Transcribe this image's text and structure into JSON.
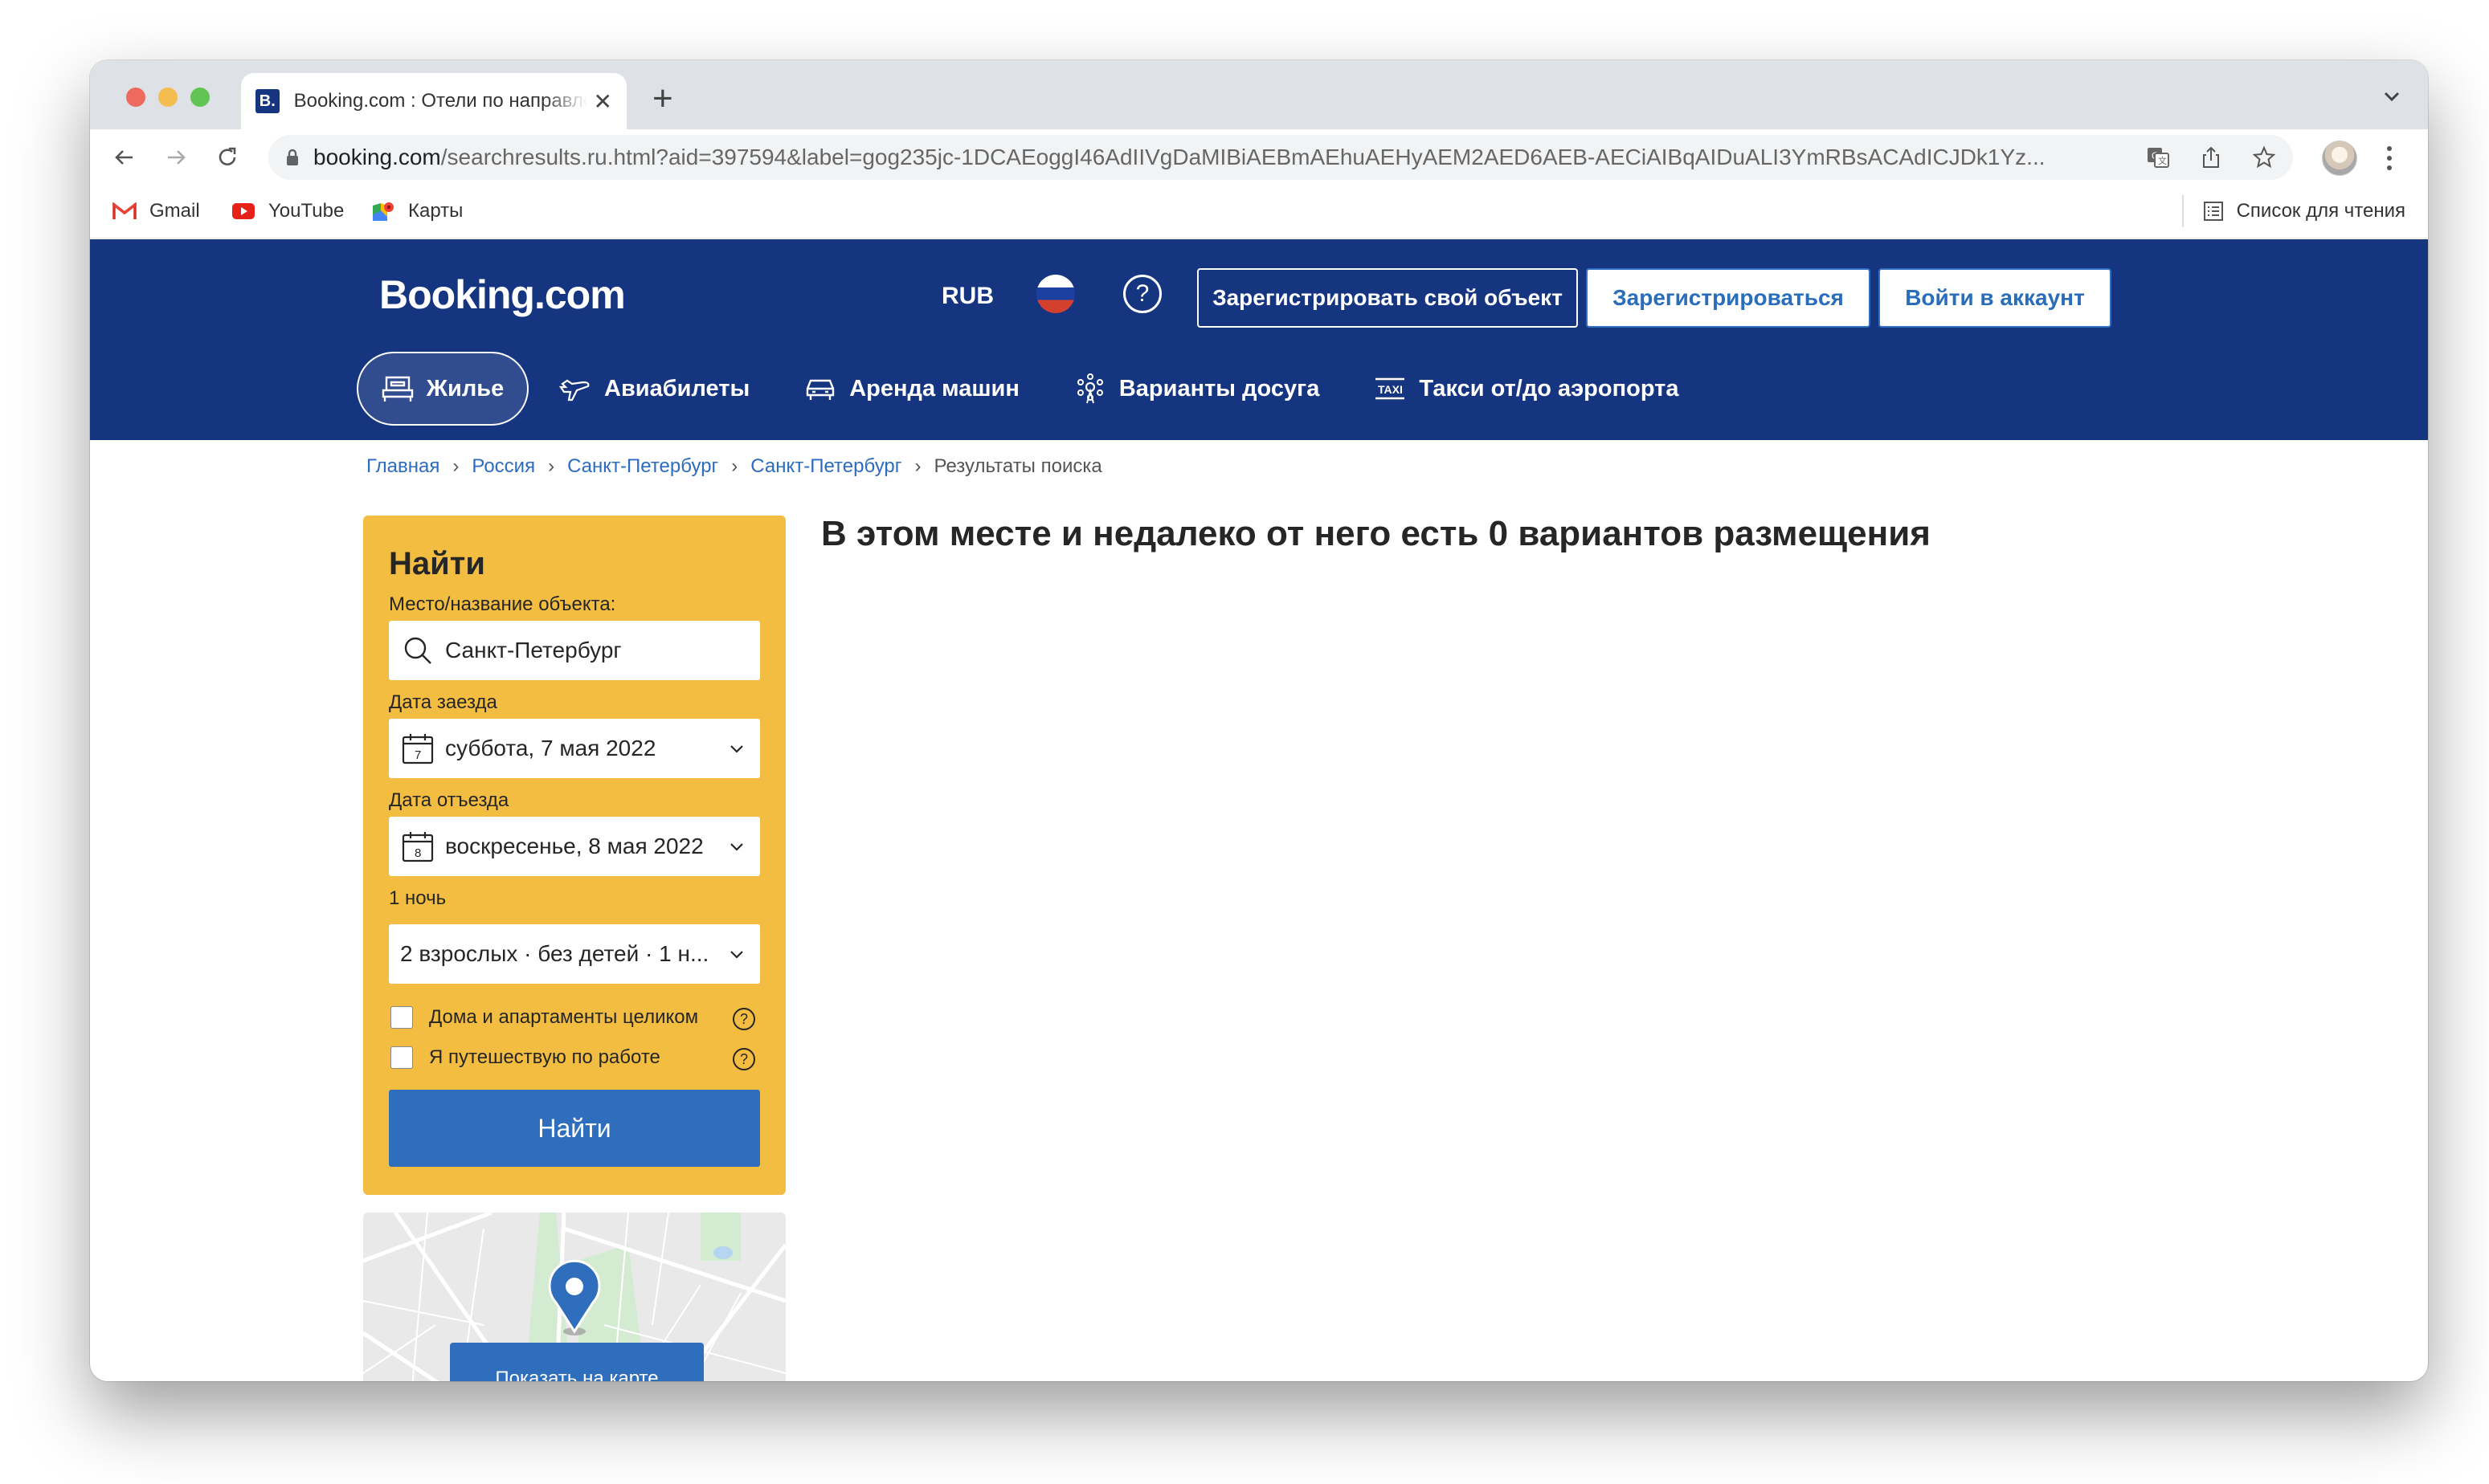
{
  "browser": {
    "tab": {
      "favicon": "B.",
      "title": "Booking.com : Отели по направлению Санкт-Петербург"
    },
    "url": {
      "host": "booking.com",
      "path": "/searchresults.ru.html?aid=397594&label=gog235jc-1DCAEoggI46AdIIVgDaMIBiAEBmAEhuAEHyAEM2AED6AEB-AECiAIBqAIDuALI3YmRBsACAdICJDk1Yz..."
    },
    "bookmarks": [
      {
        "label": "Gmail",
        "icon": "gmail-icon"
      },
      {
        "label": "YouTube",
        "icon": "youtube-icon"
      },
      {
        "label": "Карты",
        "icon": "maps-icon"
      }
    ],
    "reading_list": "Список для чтения"
  },
  "header": {
    "logo": "Booking.com",
    "currency": "RUB",
    "help": "?",
    "list_property": "Зарегистрировать свой объект",
    "register": "Зарегистрироваться",
    "sign_in": "Войти в аккаунт",
    "colors": {
      "brand_blue": "#163580",
      "action_blue": "#2f6ebd",
      "search_yellow": "#f3bd41"
    }
  },
  "nav": [
    {
      "label": "Жилье",
      "icon": "bed-icon",
      "active": true
    },
    {
      "label": "Авиабилеты",
      "icon": "plane-icon",
      "active": false
    },
    {
      "label": "Аренда машин",
      "icon": "car-icon",
      "active": false
    },
    {
      "label": "Варианты досуга",
      "icon": "attractions-icon",
      "active": false
    },
    {
      "label": "Такси от/до аэропорта",
      "icon": "taxi-icon",
      "active": false
    }
  ],
  "breadcrumb": [
    {
      "label": "Главная"
    },
    {
      "label": "Россия"
    },
    {
      "label": "Санкт-Петербург"
    },
    {
      "label": "Санкт-Петербург"
    },
    {
      "label": "Результаты поиска"
    }
  ],
  "search": {
    "title": "Найти",
    "destination_label": "Место/название объекта:",
    "destination_value": "Санкт-Петербург",
    "checkin_label": "Дата заезда",
    "checkin_value": "суббота, 7 мая 2022",
    "checkin_day": "7",
    "checkout_label": "Дата отъезда",
    "checkout_value": "воскресенье, 8 мая 2022",
    "checkout_day": "8",
    "nights": "1 ночь",
    "guests_value": "2 взрослых · без детей · 1 н...",
    "option_homes": "Дома и апартаменты целиком",
    "option_business": "Я путешествую по работе",
    "submit": "Найти"
  },
  "map": {
    "button": "Показать на карте"
  },
  "results": {
    "title": "В этом месте и недалеко от него есть 0 вариантов размещения"
  }
}
